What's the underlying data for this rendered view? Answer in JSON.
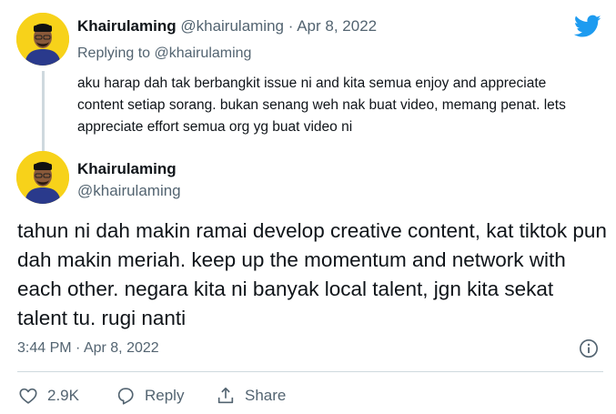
{
  "tweet1": {
    "name": "Khairulaming",
    "handle": "@khairulaming",
    "separator": "·",
    "date": "Apr 8, 2022",
    "replying_to_prefix": "Replying to",
    "replying_to_handle": "@khairulaming",
    "text": "aku harap dah tak berbangkit issue ni and kita semua enjoy and appreciate content setiap sorang. bukan senang weh nak buat video, memang penat. lets appreciate effort semua org yg buat video ni"
  },
  "tweet2": {
    "name": "Khairulaming",
    "handle": "@khairulaming",
    "text": "tahun ni dah makin ramai develop creative content, kat tiktok pun dah makin meriah. keep up the momentum and network with each other. negara kita ni banyak local talent, jgn kita sekat talent tu. rugi nanti",
    "time": "3:44 PM",
    "separator": "·",
    "date": "Apr 8, 2022"
  },
  "actions": {
    "like_count": "2.9K",
    "reply_label": "Reply",
    "share_label": "Share"
  },
  "colors": {
    "brand": "#1d9bf0",
    "muted": "#536471",
    "avatar_bg": "#f7d21a"
  },
  "icons": [
    "twitter-bird-icon",
    "info-icon",
    "heart-icon",
    "reply-bubble-icon",
    "share-icon"
  ]
}
